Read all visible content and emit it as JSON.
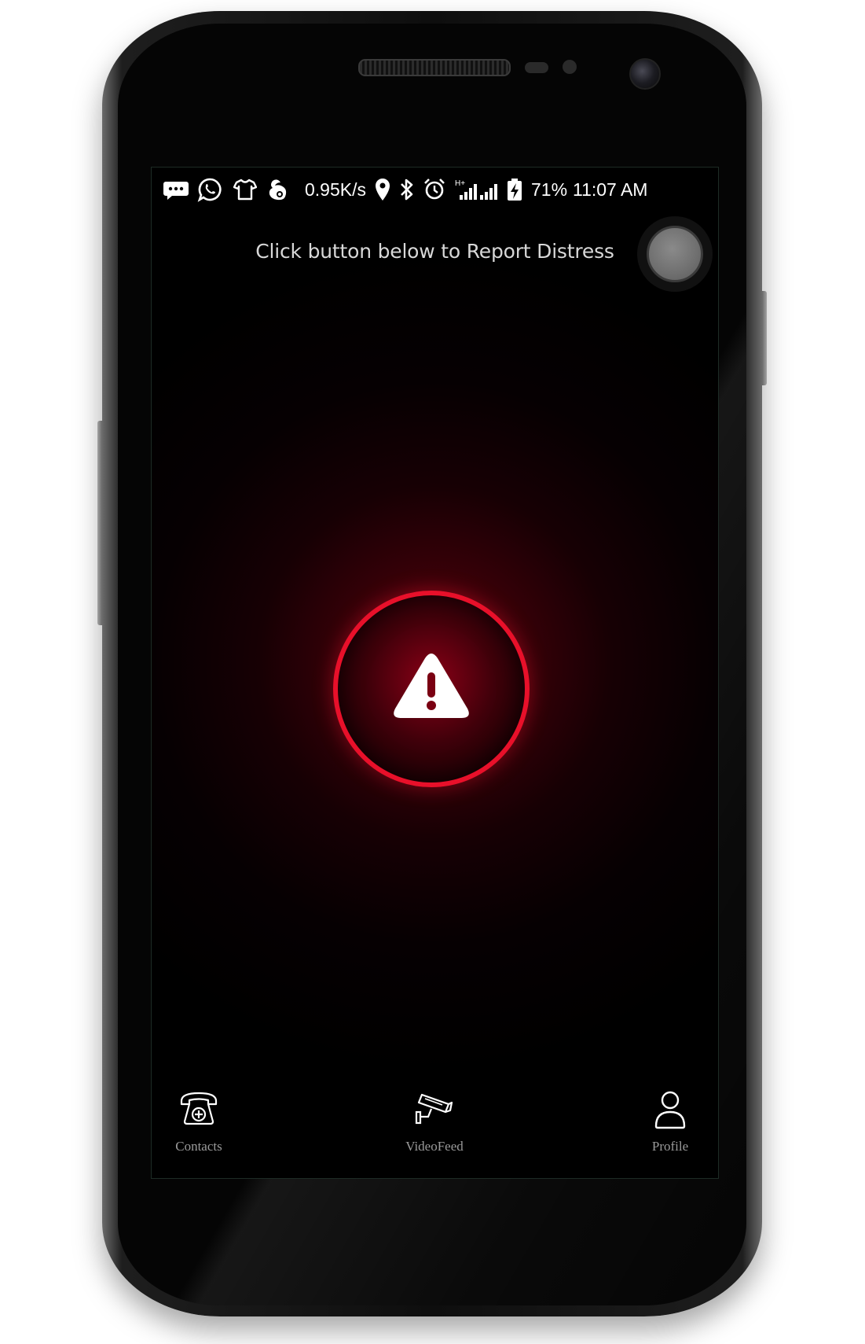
{
  "status_bar": {
    "icons": [
      "messages-icon",
      "whatsapp-icon",
      "shirt-icon",
      "uc-browser-icon"
    ],
    "net_speed": "0.95K/s",
    "right_icons": [
      "location-icon",
      "bluetooth-icon",
      "alarm-icon",
      "signal-h-plus-icon",
      "signal-icon",
      "battery-charging-icon"
    ],
    "network_label": "H+",
    "battery_percent": "71%",
    "time": "11:07 AM"
  },
  "main": {
    "instruction": "Click button below to Report Distress",
    "distress_button_icon": "warning-icon",
    "accent_color": "#e8102a"
  },
  "floating_button": {
    "icon": "assistive-touch-icon"
  },
  "bottom_nav": {
    "items": [
      {
        "label": "Contacts",
        "icon": "phone-medical-icon"
      },
      {
        "label": "VideoFeed",
        "icon": "cctv-camera-icon"
      },
      {
        "label": "Profile",
        "icon": "user-icon"
      }
    ]
  }
}
